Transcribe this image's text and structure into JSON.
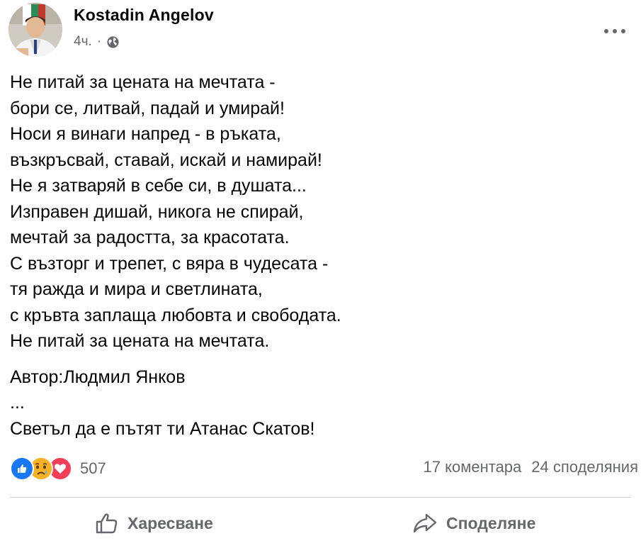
{
  "post": {
    "author": "Kostadin Angelov",
    "time": "4ч.",
    "separator": "·",
    "privacy_icon": "globe-icon",
    "poem_lines": [
      "Не питай за цената на мечтата -",
      "бори се, литвай, падай и умирай!",
      "Носи я винаги напред - в ръката,",
      "възкръсвай, ставай, искай и намирай!",
      "Не я затваряй в себе си, в душата...",
      "Изправен дишай, никога не спирай,",
      "мечтай за радостта, за красотата.",
      "С възторг и трепет, с вяра в чудесата -",
      "тя ражда и мира и светлината,",
      "с кръвта заплаща любовта и свободата.",
      "Не питай за цената на мечтата."
    ],
    "credit": "Автор:Людмил Янков",
    "ellipsis": "...",
    "closing": "Светъл да е пътят ти Атанас Скатов!"
  },
  "stats": {
    "reaction_icons": [
      "like-icon",
      "sad-icon",
      "love-icon"
    ],
    "reactions_count": "507",
    "comments": "17 коментара",
    "shares": "24 споделяния"
  },
  "actions": {
    "like_label": "Харесване",
    "share_label": "Споделяне"
  },
  "colors": {
    "like_blue": "#1877f2",
    "sad_yellow": "#f7b125",
    "love_red": "#f33e58",
    "secondary_text": "#65676b"
  }
}
